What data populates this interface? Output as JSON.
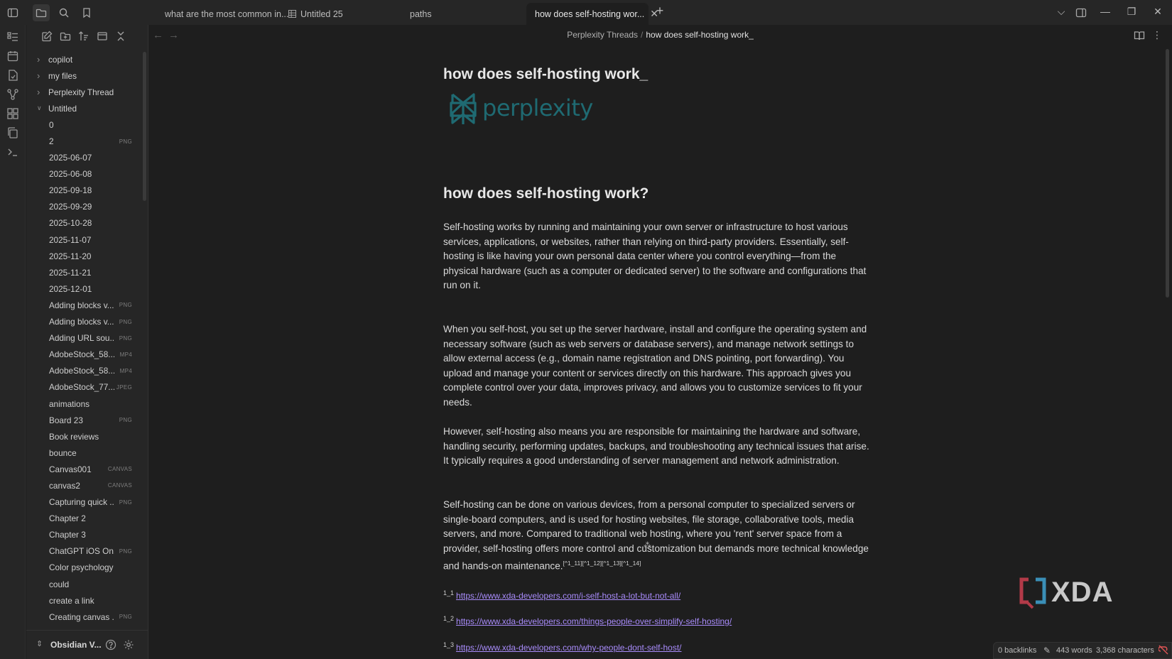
{
  "tabs": [
    {
      "label": "what are the most common in...",
      "active": false,
      "icon": ""
    },
    {
      "label": "Untitled 25",
      "active": false,
      "icon": "table-icon"
    },
    {
      "label": "paths",
      "active": false,
      "icon": ""
    },
    {
      "label": "how does self-hosting wor...",
      "active": true,
      "icon": ""
    }
  ],
  "tree": [
    {
      "label": "copilot",
      "type": "folder",
      "ext": ""
    },
    {
      "label": "my files",
      "type": "folder",
      "ext": ""
    },
    {
      "label": "Perplexity Threads",
      "type": "folder",
      "ext": ""
    },
    {
      "label": "Untitled",
      "type": "folder-open",
      "ext": ""
    },
    {
      "label": "0",
      "type": "file",
      "ext": ""
    },
    {
      "label": "2",
      "type": "file",
      "ext": "PNG"
    },
    {
      "label": "2025-06-07",
      "type": "file",
      "ext": ""
    },
    {
      "label": "2025-06-08",
      "type": "file",
      "ext": ""
    },
    {
      "label": "2025-09-18",
      "type": "file",
      "ext": ""
    },
    {
      "label": "2025-09-29",
      "type": "file",
      "ext": ""
    },
    {
      "label": "2025-10-28",
      "type": "file",
      "ext": ""
    },
    {
      "label": "2025-11-07",
      "type": "file",
      "ext": ""
    },
    {
      "label": "2025-11-20",
      "type": "file",
      "ext": ""
    },
    {
      "label": "2025-11-21",
      "type": "file",
      "ext": ""
    },
    {
      "label": "2025-12-01",
      "type": "file",
      "ext": ""
    },
    {
      "label": "Adding blocks v...",
      "type": "file",
      "ext": "PNG"
    },
    {
      "label": "Adding blocks v...",
      "type": "file",
      "ext": "PNG"
    },
    {
      "label": "Adding URL sou...",
      "type": "file",
      "ext": "PNG"
    },
    {
      "label": "AdobeStock_58...",
      "type": "file",
      "ext": "MP4"
    },
    {
      "label": "AdobeStock_58...",
      "type": "file",
      "ext": "MP4"
    },
    {
      "label": "AdobeStock_77...",
      "type": "file",
      "ext": "JPEG"
    },
    {
      "label": "animations",
      "type": "file",
      "ext": ""
    },
    {
      "label": "Board 23",
      "type": "file",
      "ext": "PNG"
    },
    {
      "label": "Book reviews",
      "type": "file",
      "ext": ""
    },
    {
      "label": "bounce",
      "type": "file",
      "ext": ""
    },
    {
      "label": "Canvas001",
      "type": "file",
      "ext": "CANVAS"
    },
    {
      "label": "canvas2",
      "type": "file",
      "ext": "CANVAS"
    },
    {
      "label": "Capturing quick ...",
      "type": "file",
      "ext": "PNG"
    },
    {
      "label": "Chapter 2",
      "type": "file",
      "ext": ""
    },
    {
      "label": "Chapter 3",
      "type": "file",
      "ext": ""
    },
    {
      "label": "ChatGPT iOS On...",
      "type": "file",
      "ext": "PNG"
    },
    {
      "label": "Color psychology",
      "type": "file",
      "ext": ""
    },
    {
      "label": "could",
      "type": "file",
      "ext": ""
    },
    {
      "label": "create a link",
      "type": "file",
      "ext": ""
    },
    {
      "label": "Creating canvas ...",
      "type": "file",
      "ext": "PNG"
    }
  ],
  "vault": {
    "name": "Obsidian V..."
  },
  "breadcrumb": {
    "parent": "Perplexity Threads",
    "separator": "/",
    "current": "how does self-hosting work_"
  },
  "doc": {
    "title": "how does self-hosting work_",
    "logo_text": "perplexity",
    "heading": "how does self-hosting work?",
    "paragraphs": [
      "Self-hosting works by running and maintaining your own server or infrastructure to host various services, applications, or websites, rather than relying on third-party providers. Essentially, self-hosting is like having your own personal data center where you control everything—from the physical hardware (such as a computer or dedicated server) to the software and configurations that run on it.",
      "When you self-host, you set up the server hardware, install and configure the operating system and necessary software (such as web servers or database servers), and manage network settings to allow external access (e.g., domain name registration and DNS pointing, port forwarding). You upload and manage your content or services directly on this hardware. This approach gives you complete control over your data, improves privacy, and allows you to customize services to fit your needs.",
      "However, self-hosting also means you are responsible for maintaining the hardware and software, handling security, performing updates, backups, and troubleshooting any technical issues that arise. It typically requires a good understanding of server management and network administration.",
      "Self-hosting can be done on various devices, from a personal computer to specialized servers or single-board computers, and is used for hosting websites, file storage, collaborative tools, media servers, and more. Compared to traditional web hosting, where you 'rent' server space from a provider, self-hosting offers more control and customization but demands more technical knowledge and hands-on maintenance."
    ],
    "footnote_refs": "[^1_11][^1_12][^1_13][^1_14]",
    "separator": "⁂",
    "links": [
      {
        "num": "1_1",
        "url": "https://www.xda-developers.com/i-self-host-a-lot-but-not-all/"
      },
      {
        "num": "1_2",
        "url": "https://www.xda-developers.com/things-people-over-simplify-self-hosting/"
      },
      {
        "num": "1_3",
        "url": "https://www.xda-developers.com/why-people-dont-self-host/"
      }
    ]
  },
  "watermark": "XDA",
  "status": {
    "backlinks": "0 backlinks",
    "words": "443 words",
    "characters": "3,368 characters"
  },
  "colors": {
    "accent_link": "#a88bfa",
    "logo": "#1f6a72",
    "sync_error": "#e05555"
  }
}
